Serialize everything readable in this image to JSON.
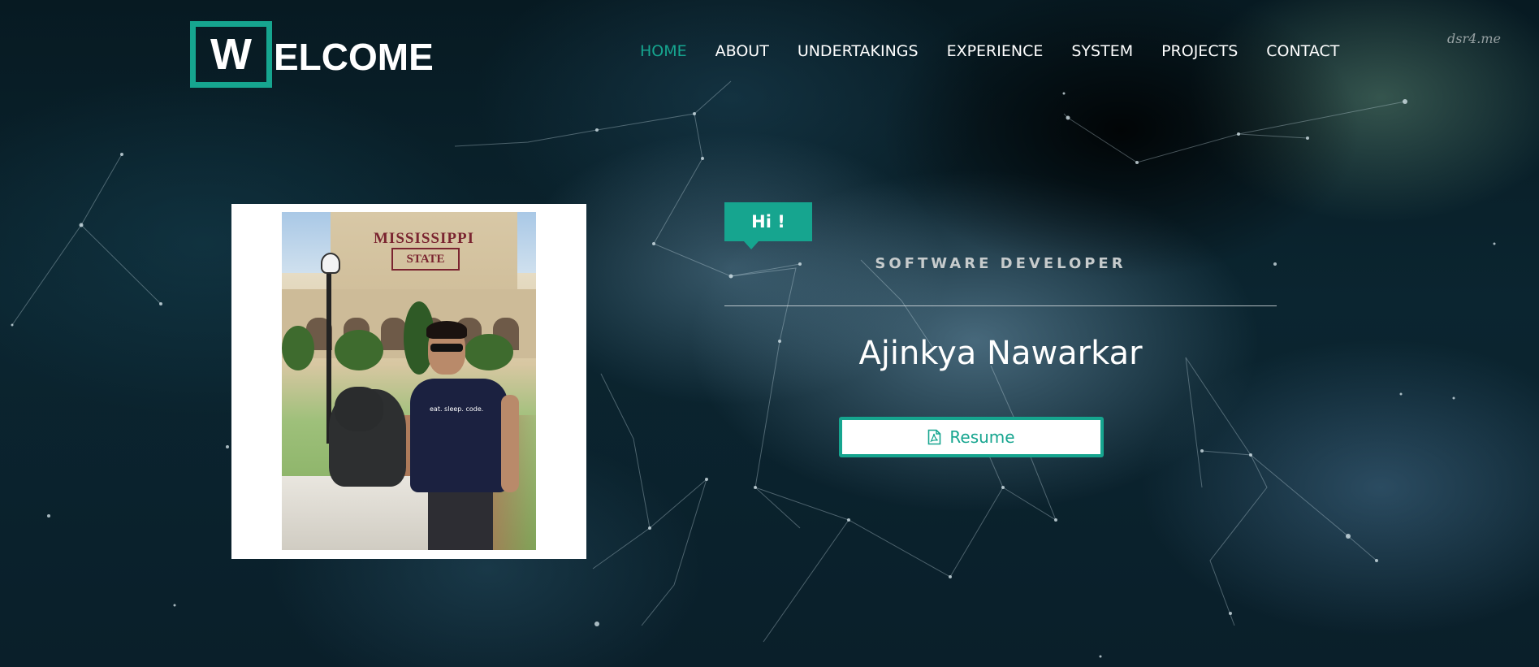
{
  "header": {
    "logo_letter": "W",
    "logo_rest": "ELCOME",
    "nav": [
      {
        "label": "HOME",
        "active": true
      },
      {
        "label": "ABOUT",
        "active": false
      },
      {
        "label": "UNDERTAKINGS",
        "active": false
      },
      {
        "label": "EXPERIENCE",
        "active": false
      },
      {
        "label": "SYSTEM",
        "active": false
      },
      {
        "label": "PROJECTS",
        "active": false
      },
      {
        "label": "CONTACT",
        "active": false
      }
    ]
  },
  "watermark": "dsr4.me",
  "hero": {
    "photo": {
      "sign_top": "MISSISSIPPI",
      "sign_state": "STATE",
      "shirt_text": "eat. sleep. code."
    },
    "greeting": "Hi !",
    "role": "SOFTWARE DEVELOPER",
    "name": "Ajinkya Nawarkar",
    "resume_label": "Resume",
    "resume_icon": "pdf-file-icon"
  },
  "colors": {
    "accent": "#16a58f",
    "nav_text": "#ffffff",
    "background": "#0b2530"
  }
}
